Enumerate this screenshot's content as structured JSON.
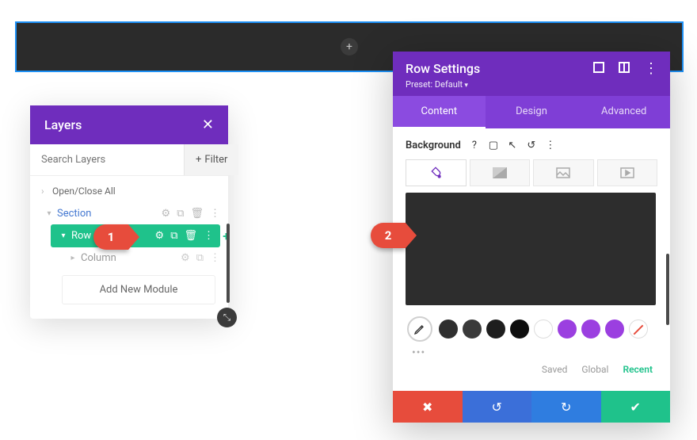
{
  "layers": {
    "title": "Layers",
    "search_placeholder": "Search Layers",
    "filter_label": "Filter",
    "open_close": "Open/Close All",
    "section_label": "Section",
    "row_label": "Row",
    "column_label": "Column",
    "add_module": "Add New Module"
  },
  "settings": {
    "title": "Row Settings",
    "preset": "Preset: Default",
    "tabs": {
      "content": "Content",
      "design": "Design",
      "advanced": "Advanced"
    },
    "bg_label": "Background",
    "swatch_tabs": {
      "saved": "Saved",
      "global": "Global",
      "recent": "Recent"
    },
    "swatches": [
      {
        "name": "dark-1",
        "color": "#2f2f2f"
      },
      {
        "name": "dark-2",
        "color": "#3a3a3a"
      },
      {
        "name": "dark-3",
        "color": "#1e1e1e"
      },
      {
        "name": "black",
        "color": "#0e0e0e"
      },
      {
        "name": "white",
        "color": "#ffffff"
      },
      {
        "name": "purple-1",
        "color": "#9b3fe0"
      },
      {
        "name": "purple-2",
        "color": "#9b3fe0"
      },
      {
        "name": "purple-3",
        "color": "#9b3fe0"
      },
      {
        "name": "none",
        "color": ""
      }
    ]
  },
  "callouts": {
    "one": "1",
    "two": "2"
  }
}
